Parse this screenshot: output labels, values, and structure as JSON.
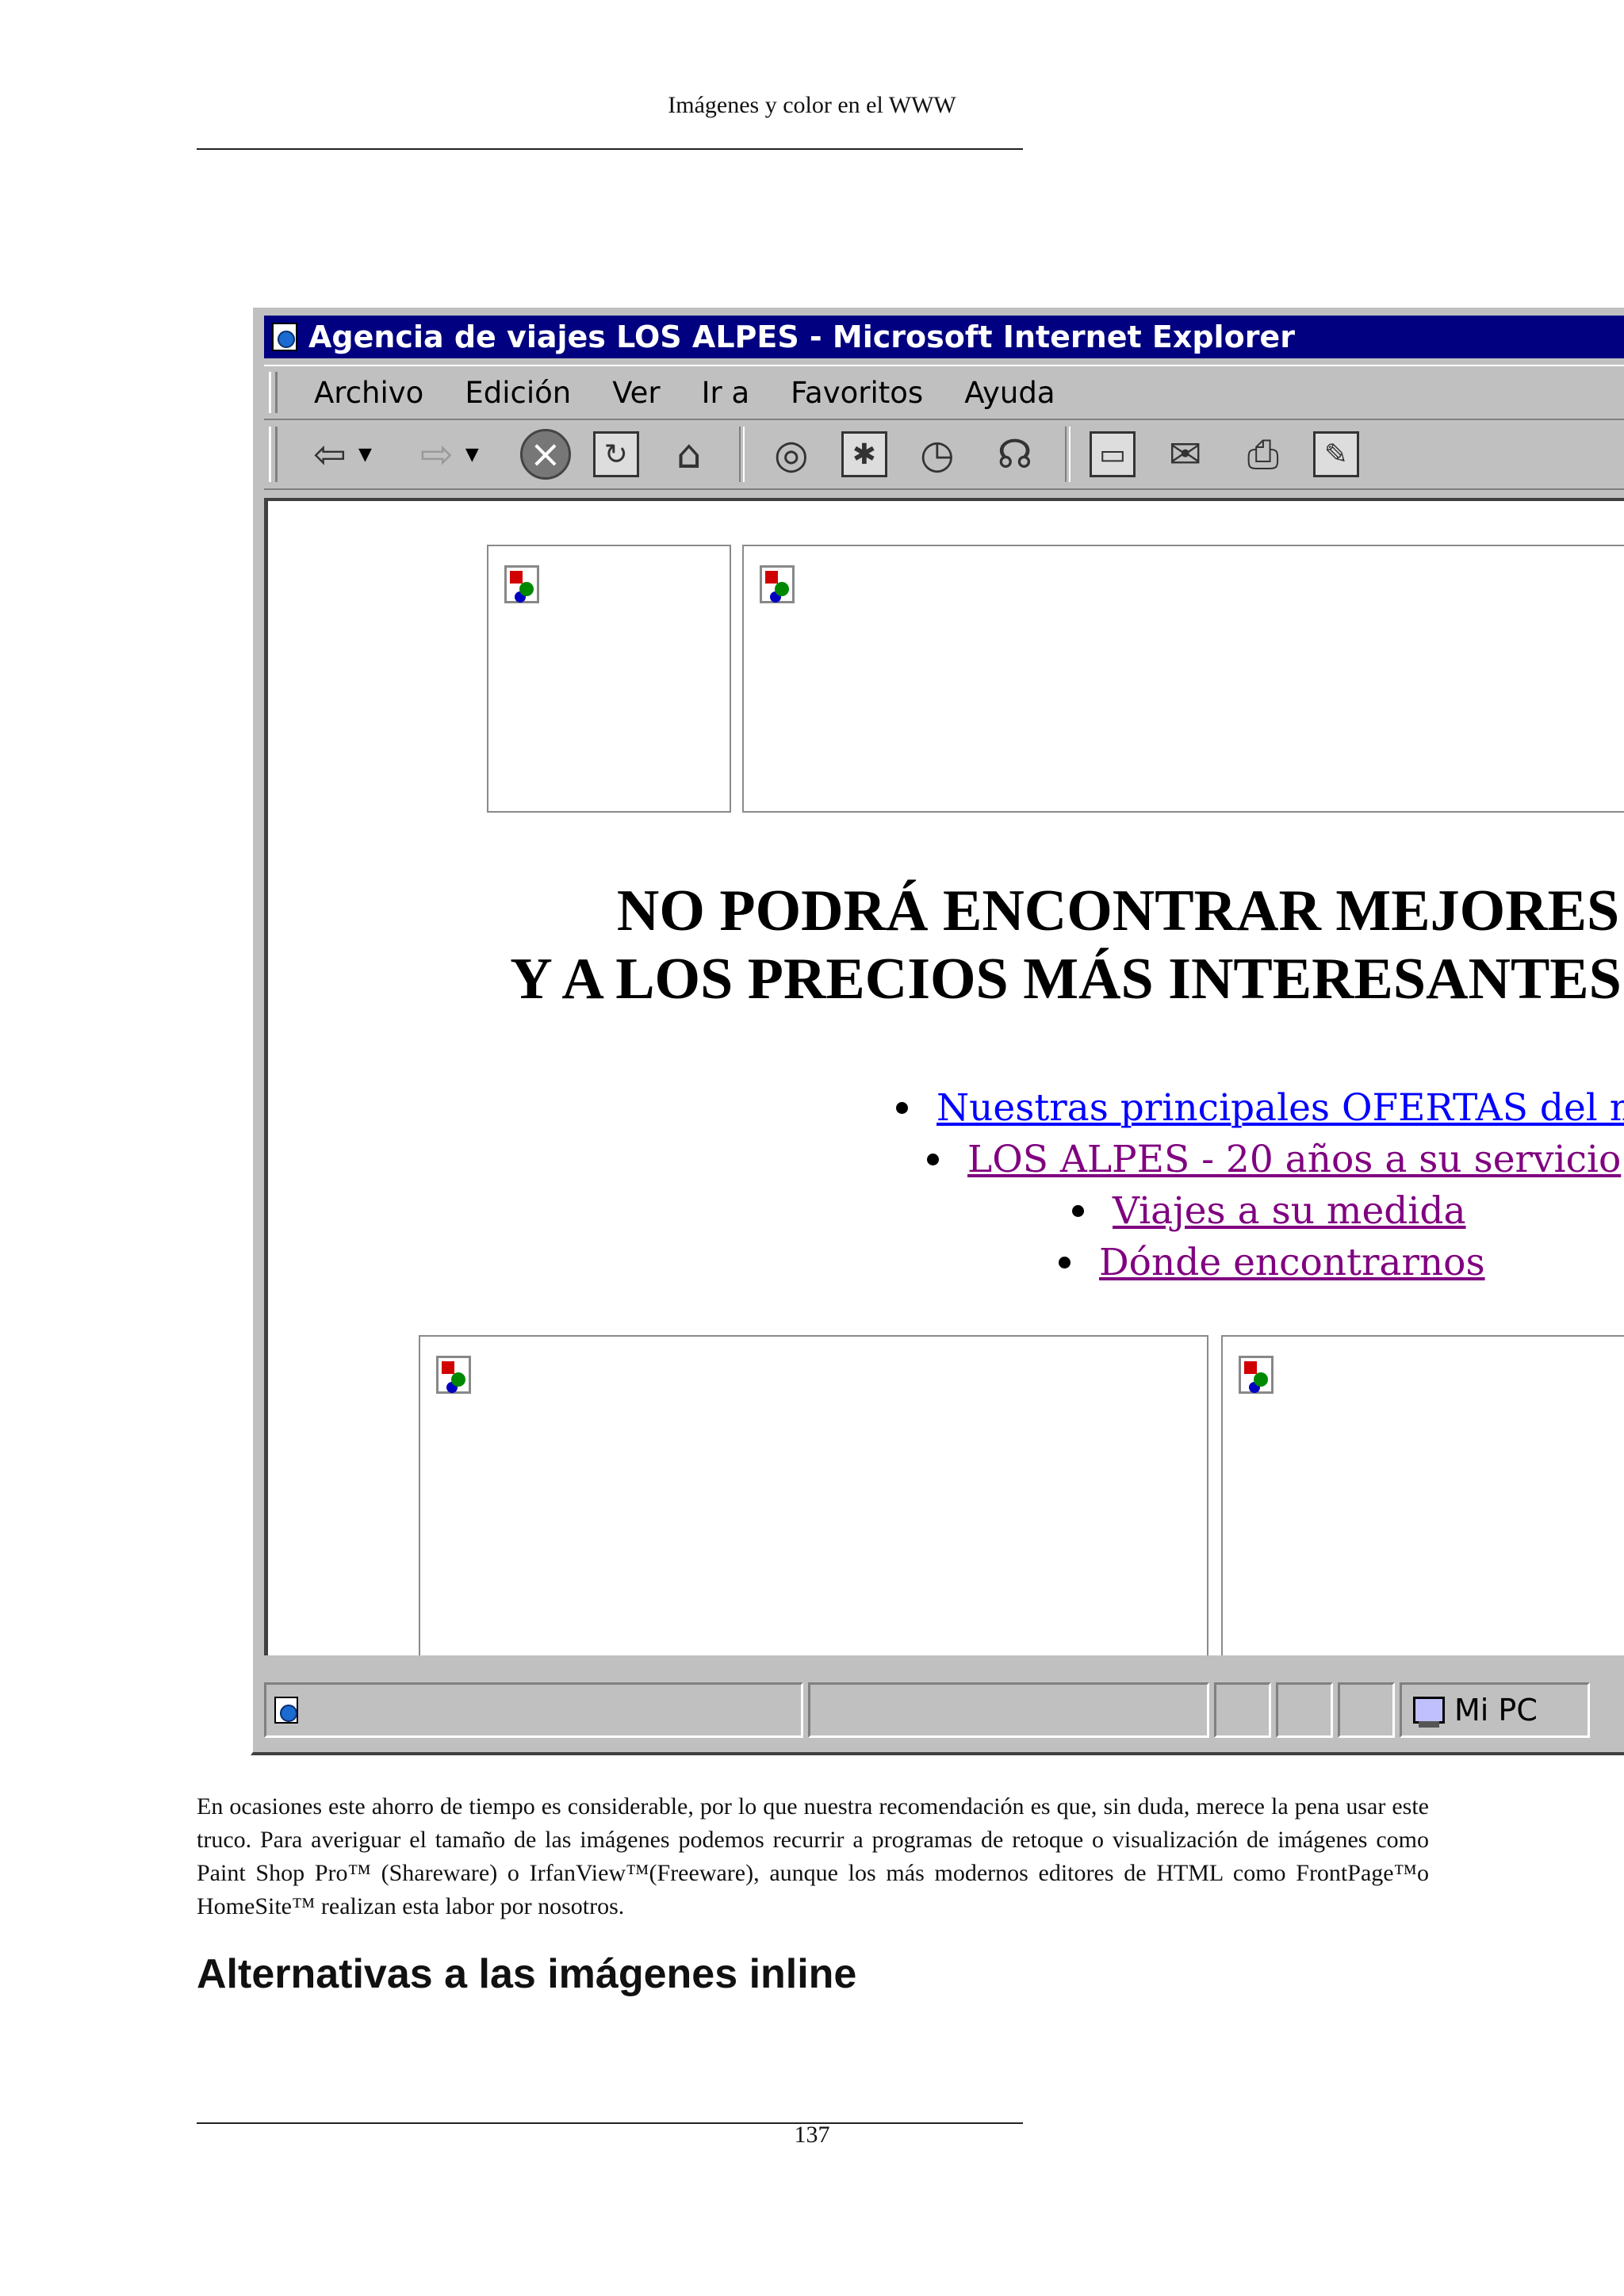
{
  "running_header": "Imágenes y color en el WWW",
  "figure": {
    "window_title": "Agencia de viajes LOS ALPES - Microsoft Internet Explorer",
    "menu": [
      "Archivo",
      "Edición",
      "Ver",
      "Ir a",
      "Favoritos",
      "Ayuda"
    ],
    "headline": [
      "NO PODRÁ ENCONTRAR MEJORES",
      "Y A LOS PRECIOS MÁS INTERESANTES D"
    ],
    "links": [
      {
        "label": "Nuestras principales OFERTAS del mes",
        "color": "#0000ff"
      },
      {
        "label": "LOS ALPES - 20 años a su servicio",
        "color": "#800080"
      },
      {
        "label": "Viajes a su medida",
        "color": "#800080"
      },
      {
        "label": "Dónde encontrarnos",
        "color": "#800080"
      }
    ],
    "status_zone": "Mi PC"
  },
  "paragraph": "En ocasiones este ahorro de tiempo es considerable, por lo que nuestra recomendación es que, sin duda, merece la pena usar este truco.  Para averiguar el tamaño de las imágenes podemos recurrir a programas de retoque o visualización de imágenes como Paint Shop Pro™ (Shareware) o IrfanView™(Freeware), aunque los más modernos editores de HTML como FrontPage™o HomeSite™ realizan esta labor por nosotros.",
  "section_heading": "Alternativas a las imágenes inline",
  "page_number": "137"
}
